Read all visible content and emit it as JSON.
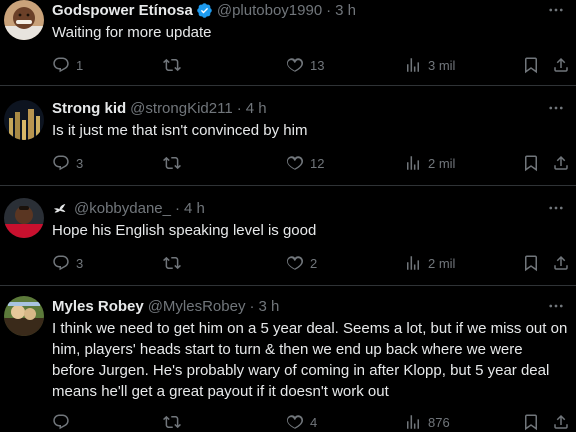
{
  "tweets": [
    {
      "name": "Godspower Etínosa",
      "handle": "@plutoboy1990",
      "time": "3 h",
      "verified": true,
      "text": "Waiting for more update",
      "replies": "1",
      "retweets": "",
      "likes": "13",
      "views": "3 mil"
    },
    {
      "name": "Strong kid",
      "handle": "@strongKid211",
      "time": "4 h",
      "verified": false,
      "text": "Is it just me that isn't convinced by him",
      "replies": "3",
      "retweets": "",
      "likes": "12",
      "views": "2 mil"
    },
    {
      "name": "",
      "handle": "@kobbydane_",
      "time": "4 h",
      "verified": false,
      "name_icon": "dove-icon",
      "text": "Hope his English speaking level is good",
      "replies": "3",
      "retweets": "",
      "likes": "2",
      "views": "2 mil"
    },
    {
      "name": "Myles Robey",
      "handle": "@MylesRobey",
      "time": "3 h",
      "verified": false,
      "text": "I think we need to get him on a 5 year deal. Seems a lot, but if we miss out on him, players' heads start to turn & then we end up back where we were before Jurgen. He's probably wary of coming in after Klopp, but 5 year deal means he'll get a great payout if it doesn't work out",
      "replies": "",
      "retweets": "",
      "likes": "4",
      "views": "876"
    }
  ],
  "separator": "·",
  "icons": {
    "reply": "reply-icon",
    "retweet": "retweet-icon",
    "like": "heart-icon",
    "views": "views-icon",
    "bookmark": "bookmark-icon",
    "share": "share-icon",
    "more": "more-icon",
    "verified": "verified-badge-icon"
  },
  "colors": {
    "background": "#000000",
    "text": "#e7e9ea",
    "secondary": "#71767b",
    "divider": "#2f3336",
    "verified": "#1d9bf0"
  }
}
